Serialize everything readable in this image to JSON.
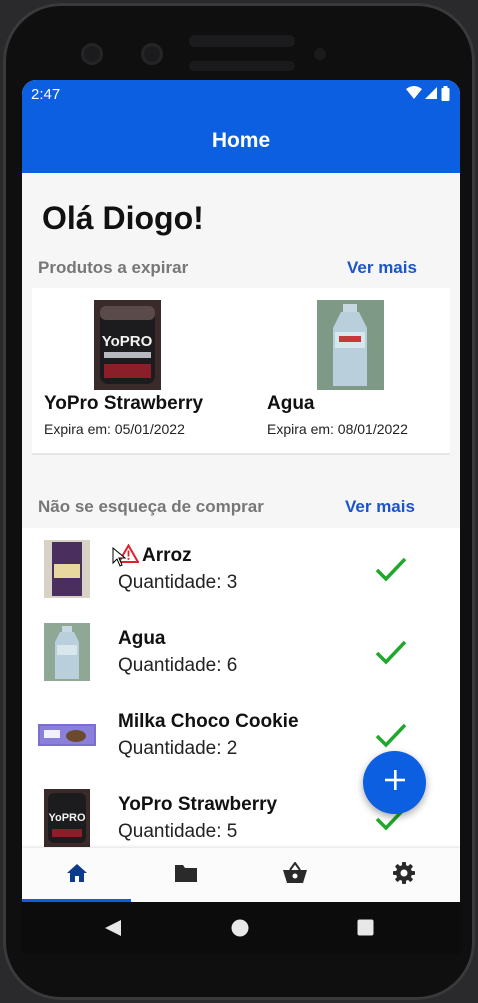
{
  "status_bar": {
    "time": "2:47",
    "icons": [
      "wifi-icon",
      "signal-icon",
      "battery-icon"
    ]
  },
  "app_bar": {
    "title": "Home"
  },
  "greeting": "Olá Diogo!",
  "expiring": {
    "section_title": "Produtos a expirar",
    "see_more": "Ver mais",
    "items": [
      {
        "name": "YoPro Strawberry",
        "expires": "Expira em: 05/01/2022"
      },
      {
        "name": "Agua",
        "expires": "Expira em: 08/01/2022"
      }
    ]
  },
  "shopping": {
    "section_title": "Não se esqueça de comprar",
    "see_more": "Ver mais",
    "items": [
      {
        "name": "Arroz",
        "quantity": "Quantidade: 3",
        "warning": true
      },
      {
        "name": "Agua",
        "quantity": "Quantidade: 6"
      },
      {
        "name": "Milka Choco Cookie",
        "quantity": "Quantidade: 2"
      },
      {
        "name": "YoPro Strawberry",
        "quantity": "Quantidade: 5"
      }
    ]
  },
  "fab": {
    "icon": "plus-icon"
  },
  "bottom_nav": {
    "items": [
      "home-icon",
      "folder-icon",
      "basket-icon",
      "settings-icon"
    ],
    "active": "home-icon"
  },
  "system_nav": [
    "back-icon",
    "home-circle-icon",
    "recents-icon"
  ],
  "colors": {
    "primary": "#0b5fe0",
    "link": "#1a55c9",
    "check": "#1fa82b",
    "warning": "#e0202a"
  }
}
